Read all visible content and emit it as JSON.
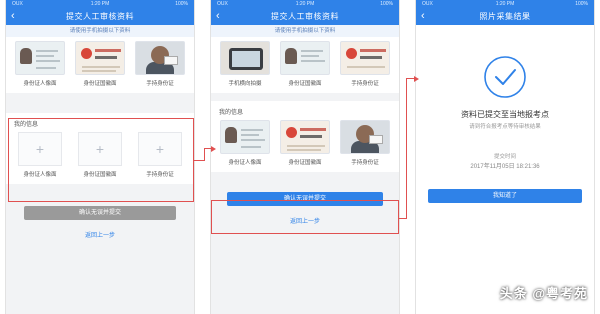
{
  "status_bar": {
    "carrier": "OUX",
    "time": "1:20 PM",
    "battery": "100%"
  },
  "screen1": {
    "title": "提交人工审核资料",
    "hint": "请使用手机拍摄以下资料",
    "samples": [
      {
        "label": "身份证人像面"
      },
      {
        "label": "身份证国徽面"
      },
      {
        "label": "手持身份证"
      }
    ],
    "my_info_label": "我的信息",
    "uploads": [
      {
        "label": "身份证人像面",
        "icon": "plus-icon"
      },
      {
        "label": "身份证国徽面",
        "icon": "plus-icon"
      },
      {
        "label": "手持身份证",
        "icon": "plus-icon"
      }
    ],
    "submit_label": "确认无误并提交",
    "back_link": "返回上一步"
  },
  "screen2": {
    "title": "提交人工审核资料",
    "hint": "请使用手机拍摄以下资料",
    "samples": [
      {
        "label": "手机横向拍摄"
      },
      {
        "label": "身份证国徽面"
      },
      {
        "label": "手持身份证"
      }
    ],
    "my_info_label": "我的信息",
    "uploads": [
      {
        "label": "身份证人像面"
      },
      {
        "label": "身份证国徽面"
      },
      {
        "label": "手持身份证"
      }
    ],
    "submit_label": "确认无误并提交",
    "back_link": "返回上一步"
  },
  "screen3": {
    "title": "照片采集结果",
    "result_title": "资料已提交至当地报考点",
    "result_sub": "请到符合报考点等待审核结果",
    "time_label": "提交时间",
    "time_value": "2017年11月05日 18:21:36",
    "done_label": "我知道了"
  },
  "watermark": "头条 @粤考苑",
  "colors": {
    "primary": "#2f82e8",
    "highlight": "#e05050",
    "disabled": "#9a9a9a"
  }
}
